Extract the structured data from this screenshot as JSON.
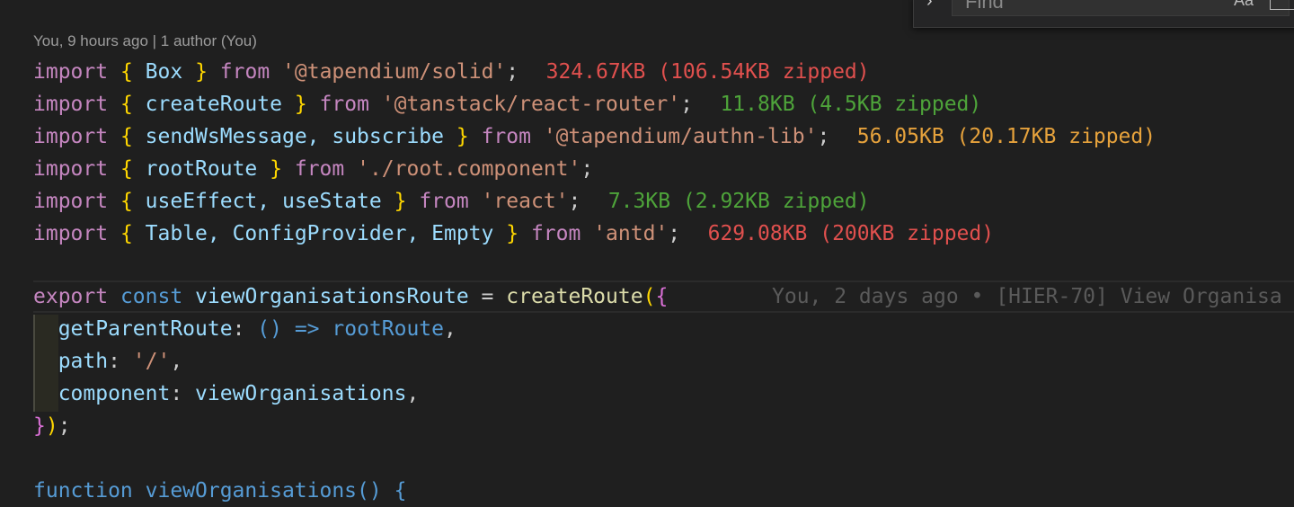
{
  "find": {
    "placeholder": "Find",
    "match_case_label": "Aa",
    "whole_word_label": "ab"
  },
  "codelens": "You, 9 hours ago | 1 author (You)",
  "imports": [
    {
      "kw": "import",
      "open": "{",
      "names": " Box ",
      "close": "}",
      "from": "from",
      "module": "'@tapendium/solid'",
      "semi": ";",
      "size": "324.67KB (106.54KB zipped)",
      "size_color": "#e0504e"
    },
    {
      "kw": "import",
      "open": "{",
      "names": " createRoute ",
      "close": "}",
      "from": "from",
      "module": "'@tanstack/react-router'",
      "semi": ";",
      "size": "11.8KB (4.5KB zipped)",
      "size_color": "#4ea43a"
    },
    {
      "kw": "import",
      "open": "{",
      "names": " sendWsMessage, subscribe ",
      "close": "}",
      "from": "from",
      "module": "'@tapendium/authn-lib'",
      "semi": ";",
      "size": "56.05KB (20.17KB zipped)",
      "size_color": "#e6a23c"
    },
    {
      "kw": "import",
      "open": "{",
      "names": " rootRoute ",
      "close": "}",
      "from": "from",
      "module": "'./root.component'",
      "semi": ";",
      "size": "",
      "size_color": ""
    },
    {
      "kw": "import",
      "open": "{",
      "names": " useEffect, useState ",
      "close": "}",
      "from": "from",
      "module": "'react'",
      "semi": ";",
      "size": "7.3KB (2.92KB zipped)",
      "size_color": "#4ea43a"
    },
    {
      "kw": "import",
      "open": "{",
      "names": " Table, ConfigProvider, Empty ",
      "close": "}",
      "from": "from",
      "module": "'antd'",
      "semi": ";",
      "size": "629.08KB (200KB zipped)",
      "size_color": "#e0504e"
    }
  ],
  "export_line": {
    "export": "export",
    "const": "const",
    "name": "viewOrganisationsRoute",
    "eq": " = ",
    "fn": "createRoute",
    "paren": "(",
    "brace": "{",
    "blame": "You, 2 days ago • [HIER-70] View Organisa"
  },
  "props": [
    {
      "key": "getParentRoute",
      "colon": ": ",
      "value_parts": [
        {
          "t": "()",
          "c": "kw2"
        },
        {
          "t": " => ",
          "c": "kw2"
        },
        {
          "t": "rootRoute",
          "c": "kw2"
        },
        {
          "t": ",",
          "c": "pl"
        }
      ]
    },
    {
      "key": "path",
      "colon": ": ",
      "value_parts": [
        {
          "t": "'/'",
          "c": "str"
        },
        {
          "t": ",",
          "c": "pl"
        }
      ]
    },
    {
      "key": "component",
      "colon": ": ",
      "value_parts": [
        {
          "t": "viewOrganisations",
          "c": "id"
        },
        {
          "t": ",",
          "c": "pl"
        }
      ]
    }
  ],
  "close_line": {
    "brace": "}",
    "paren": ")",
    "semi": ";"
  },
  "partial_line": "function viewOrganisations() {"
}
